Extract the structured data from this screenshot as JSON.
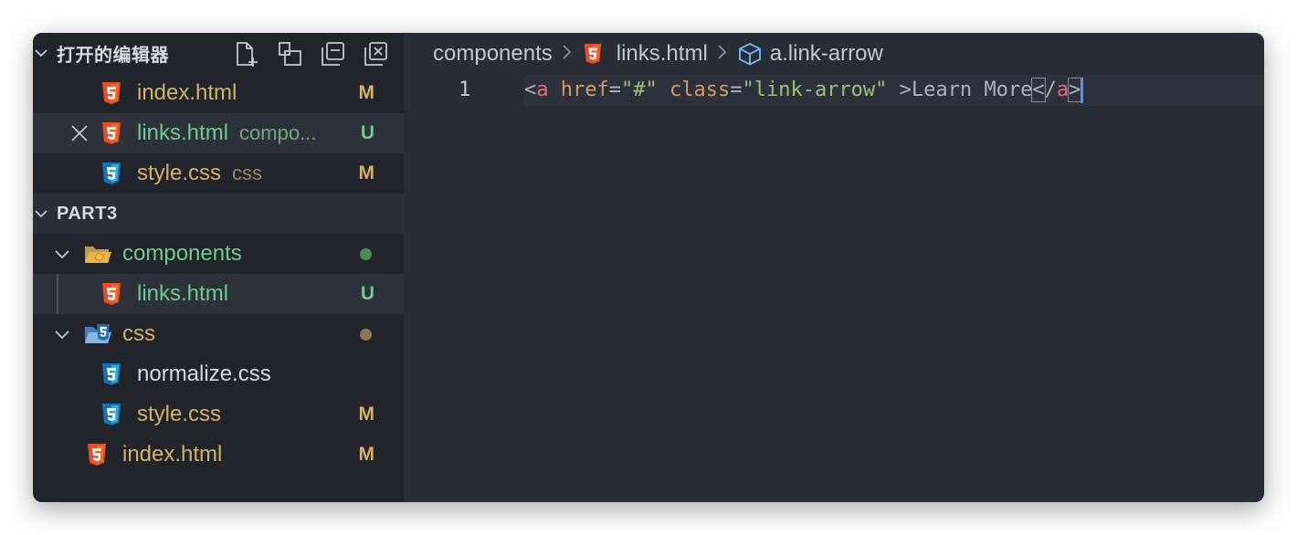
{
  "open_editors": {
    "title": "打开的编辑器",
    "items": [
      {
        "name": "index.html",
        "desc": "",
        "badge": "M",
        "type": "html"
      },
      {
        "name": "links.html",
        "desc": "compo...",
        "badge": "U",
        "type": "html"
      },
      {
        "name": "style.css",
        "desc": "css",
        "badge": "M",
        "type": "css"
      }
    ]
  },
  "explorer": {
    "title": "PART3",
    "folders": [
      {
        "name": "components",
        "children": [
          {
            "name": "links.html",
            "badge": "U"
          }
        ]
      },
      {
        "name": "css",
        "children": [
          {
            "name": "normalize.css",
            "badge": ""
          },
          {
            "name": "style.css",
            "badge": "M"
          }
        ]
      }
    ],
    "root_files": [
      {
        "name": "index.html",
        "badge": "M"
      }
    ]
  },
  "breadcrumb": {
    "folder": "components",
    "file": "links.html",
    "symbol": "a.link-arrow"
  },
  "editor": {
    "line_number": "1",
    "tokens": {
      "open_lt": "<",
      "tag": "a",
      "attr1": "href",
      "eq1": "=",
      "val1": "\"#\"",
      "attr2": "class",
      "eq2": "=",
      "val2": "\"link-arrow\"",
      "text": " >Learn More",
      "close_lt": "<",
      "close_slash": "/",
      "close_tag": "a",
      "close_gt": ">"
    }
  },
  "colors": {
    "html_icon": "#e44d26",
    "css_icon": "#1572b6",
    "modified": "#d3b36b",
    "untracked": "#73c991"
  }
}
